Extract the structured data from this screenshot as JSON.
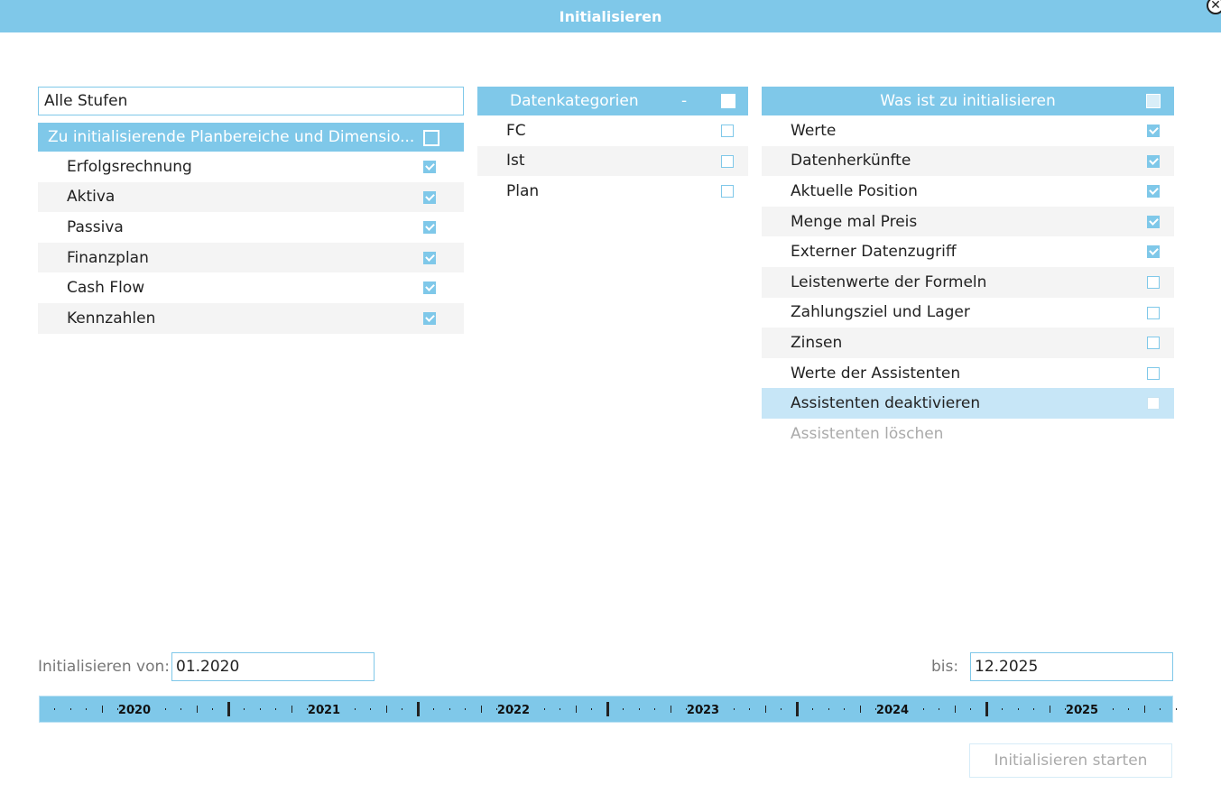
{
  "window": {
    "title": "Initialisieren"
  },
  "stages": {
    "filter_value": "Alle Stufen",
    "header_label": "Zu initialisierende Planbereiche und Dimensio...",
    "header_checked": true,
    "items": [
      {
        "label": "Erfolgsrechnung",
        "checked": true
      },
      {
        "label": "Aktiva",
        "checked": true
      },
      {
        "label": "Passiva",
        "checked": true
      },
      {
        "label": "Finanzplan",
        "checked": true
      },
      {
        "label": "Cash Flow",
        "checked": true
      },
      {
        "label": "Kennzahlen",
        "checked": true
      }
    ]
  },
  "categories": {
    "header_label": "Datenkategorien",
    "header_dash": "-",
    "items": [
      {
        "label": "FC",
        "checked": false
      },
      {
        "label": "Ist",
        "checked": false
      },
      {
        "label": "Plan",
        "checked": false
      }
    ]
  },
  "what": {
    "header_label": "Was ist zu initialisieren",
    "items": [
      {
        "label": "Werte",
        "checked": true
      },
      {
        "label": "Datenherkünfte",
        "checked": true
      },
      {
        "label": "Aktuelle Position",
        "checked": true
      },
      {
        "label": "Menge mal Preis",
        "checked": true
      },
      {
        "label": "Externer Datenzugriff",
        "checked": true
      },
      {
        "label": "Leistenwerte der Formeln",
        "checked": false
      },
      {
        "label": "Zahlungsziel und Lager",
        "checked": false
      },
      {
        "label": "Zinsen",
        "checked": false
      },
      {
        "label": "Werte der Assistenten",
        "checked": false
      },
      {
        "label": "Assistenten deaktivieren",
        "checked": false,
        "highlighted": true
      },
      {
        "label": "Assistenten löschen",
        "disabled": true
      }
    ]
  },
  "period": {
    "from_label": "Initialisieren von:",
    "from_value": "01.2020",
    "to_label": "bis:",
    "to_value": "12.2025"
  },
  "timeline": {
    "years": [
      "2020",
      "2021",
      "2022",
      "2023",
      "2024",
      "2025"
    ]
  },
  "actions": {
    "start_label": "Initialisieren starten",
    "start_enabled": false
  },
  "colors": {
    "accent": "#7fc8e9",
    "row_alt": "#f4f4f4",
    "row_highlight": "#c7e6f7"
  }
}
